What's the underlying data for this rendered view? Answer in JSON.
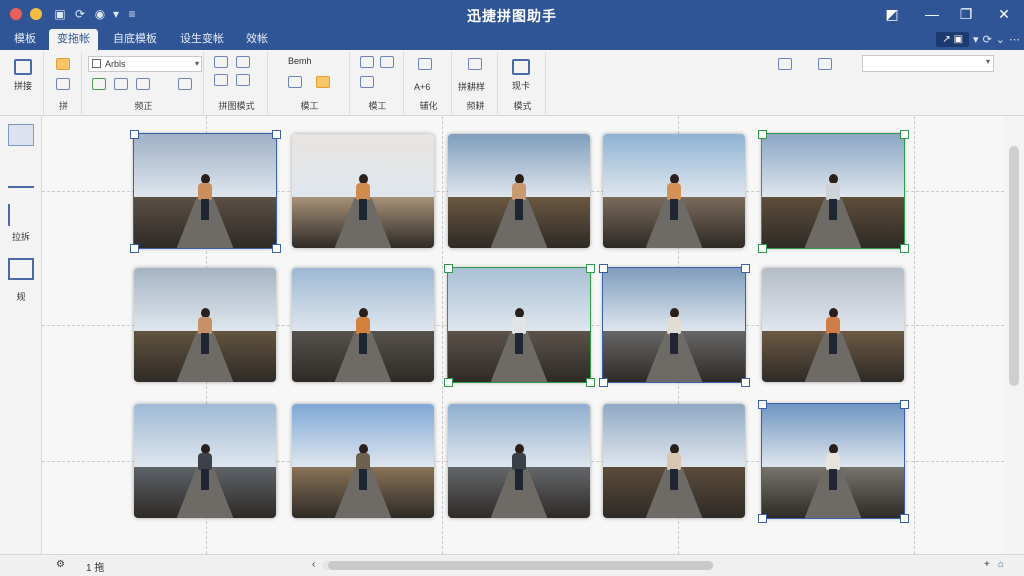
{
  "window": {
    "title": "迅捷拼图助手"
  },
  "tabs": [
    "模板",
    "变拖帐",
    "自底模板",
    "设生变帐",
    "效帐"
  ],
  "active_tab_index": 1,
  "ribbon": {
    "groups": [
      {
        "label": "拼接"
      },
      {
        "label": "拼"
      },
      {
        "label": "频正"
      },
      {
        "label": "拼图模式"
      },
      {
        "label": "模工"
      },
      {
        "label": "辅化"
      },
      {
        "label": "频耕"
      },
      {
        "label": "模式"
      }
    ],
    "big_buttons": [
      {
        "label": "拼接"
      },
      {
        "label": "现卡"
      }
    ],
    "font_value": "Arbls",
    "aux_text": "Bemh",
    "aux_text2": "A+6",
    "aux_text3": "拼耕样"
  },
  "left_panel": {
    "tools": [
      {
        "label": "",
        "icon": "layout-icon"
      },
      {
        "label": "",
        "icon": "pencil-icon"
      },
      {
        "label": "拉拆",
        "icon": "crop-icon"
      },
      {
        "label": "规",
        "icon": "arrange-icon"
      }
    ]
  },
  "canvas": {
    "rows": [
      [
        {
          "name": "woman-pier-cloudy",
          "sky": "#9fb1c6",
          "ground": "#5b4f45",
          "torso": "#c9905e",
          "selected": "blue"
        },
        {
          "name": "woman-painting-wall",
          "sky": "#e8e4df",
          "ground": "#a89279",
          "torso": "#d08a4e",
          "selected": ""
        },
        {
          "name": "woman-field-sunset",
          "sky": "#7f9dbd",
          "ground": "#6b5842",
          "torso": "#c99a6e",
          "selected": ""
        },
        {
          "name": "woman-boardwalk-lake",
          "sky": "#8fb3d3",
          "ground": "#7a6b5b",
          "torso": "#d29256",
          "selected": ""
        },
        {
          "name": "man-field-dusk",
          "sky": "#8aa6c3",
          "ground": "#5e4e3a",
          "torso": "#cfd3d8",
          "selected": "green"
        }
      ],
      [
        {
          "name": "woman-shore-rocks",
          "sky": "#a5b4c2",
          "ground": "#62543f",
          "torso": "#c89066",
          "selected": ""
        },
        {
          "name": "woman-pier-sea",
          "sky": "#9db8d3",
          "ground": "#57524e",
          "torso": "#d2813f",
          "selected": ""
        },
        {
          "name": "man-dock-pier",
          "sky": "#a9c0d6",
          "ground": "#5b524a",
          "torso": "#e1e3e6",
          "selected": "green"
        },
        {
          "name": "woman-waterfront-building",
          "sky": "#7f9dbd",
          "ground": "#676767",
          "torso": "#e2ddd4",
          "selected": "blue"
        },
        {
          "name": "woman-grass-field",
          "sky": "#b4bcc6",
          "ground": "#6c5a44",
          "torso": "#d07c47",
          "selected": ""
        }
      ],
      [
        {
          "name": "man-pier-backpack",
          "sky": "#9fbad6",
          "ground": "#5e6369",
          "torso": "#3c414a",
          "selected": ""
        },
        {
          "name": "man-beach-backpack",
          "sky": "#7fa7d6",
          "ground": "#8a7358",
          "torso": "#6e6150",
          "selected": ""
        },
        {
          "name": "man-boardwalk-ocean",
          "sky": "#90aecf",
          "ground": "#64676b",
          "torso": "#3b4149",
          "selected": ""
        },
        {
          "name": "woman-field-trees",
          "sky": "#8fa9c3",
          "ground": "#5b4c3a",
          "torso": "#d8c6b0",
          "selected": ""
        },
        {
          "name": "man-promenade-city",
          "sky": "#6f95c1",
          "ground": "#77736d",
          "torso": "#e6e2dc",
          "selected": "blue"
        }
      ]
    ]
  },
  "status_bar": {
    "page_label": "1 拖"
  },
  "colors": {
    "titlebar": "#2f5597",
    "accent": "#3b5fa8",
    "selection_green": "#2f9a49"
  }
}
